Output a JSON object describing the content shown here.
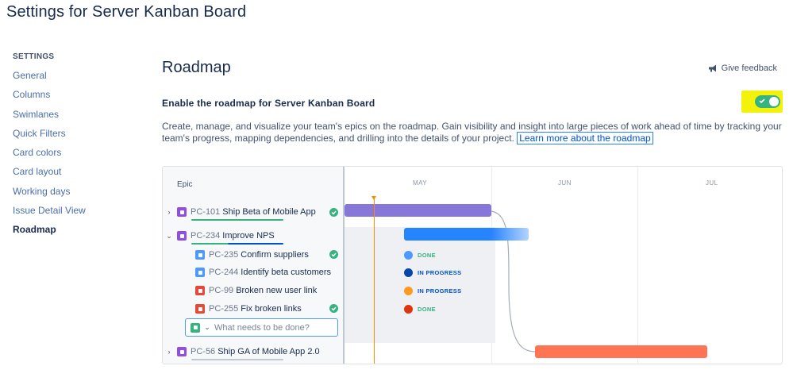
{
  "page_title": "Settings for Server Kanban Board",
  "sidebar": {
    "heading": "SETTINGS",
    "items": [
      {
        "label": "General"
      },
      {
        "label": "Columns"
      },
      {
        "label": "Swimlanes"
      },
      {
        "label": "Quick Filters"
      },
      {
        "label": "Card colors"
      },
      {
        "label": "Card layout"
      },
      {
        "label": "Working days"
      },
      {
        "label": "Issue Detail View"
      },
      {
        "label": "Roadmap",
        "active": true
      }
    ]
  },
  "main": {
    "title": "Roadmap",
    "feedback_label": "Give feedback",
    "enable_label": "Enable the roadmap for Server Kanban Board",
    "toggle_on": true,
    "description": "Create, manage, and visualize your team's epics on the roadmap. Gain visibility and insight into large pieces of work ahead of time by tracking your team's progress, mapping dependencies, and drilling into the details of your project.",
    "learn_more": "Learn more about the roadmap"
  },
  "preview": {
    "epic_header": "Epic",
    "months": [
      "MAY",
      "JUN",
      "JUL"
    ],
    "rows": [
      {
        "key": "PC-101",
        "label": "Ship Beta of Mobile App",
        "type": "epic",
        "chevron": "›",
        "done": true
      },
      {
        "key": "PC-234",
        "label": "Improve NPS",
        "type": "epic",
        "chevron": "⌄",
        "done": false
      },
      {
        "key": "PC-235",
        "label": "Confirm suppliers",
        "type": "task",
        "done": true,
        "status": "DONE"
      },
      {
        "key": "PC-244",
        "label": "Identify beta customers",
        "type": "task",
        "done": false,
        "status": "IN PROGRESS"
      },
      {
        "key": "PC-99",
        "label": "Broken new user link",
        "type": "bug",
        "done": false,
        "status": "IN PROGRESS"
      },
      {
        "key": "PC-255",
        "label": "Fix broken links",
        "type": "bug",
        "done": true,
        "status": "DONE"
      },
      {
        "key": "PC-56",
        "label": "Ship GA of Mobile App 2.0",
        "type": "epic",
        "chevron": "›",
        "done": false
      }
    ],
    "create_placeholder": "What needs to be done?"
  },
  "colors": {
    "epic": "#904ee2",
    "task": "#4c9aff",
    "bug": "#e5493a",
    "story": "#36b37e",
    "done": "#36b37e",
    "in_progress": "#0052cc",
    "bar_purple": "#8777d9",
    "bar_blue": "#2684ff",
    "bar_red": "#ff7452",
    "highlight": "#f2f20a"
  }
}
